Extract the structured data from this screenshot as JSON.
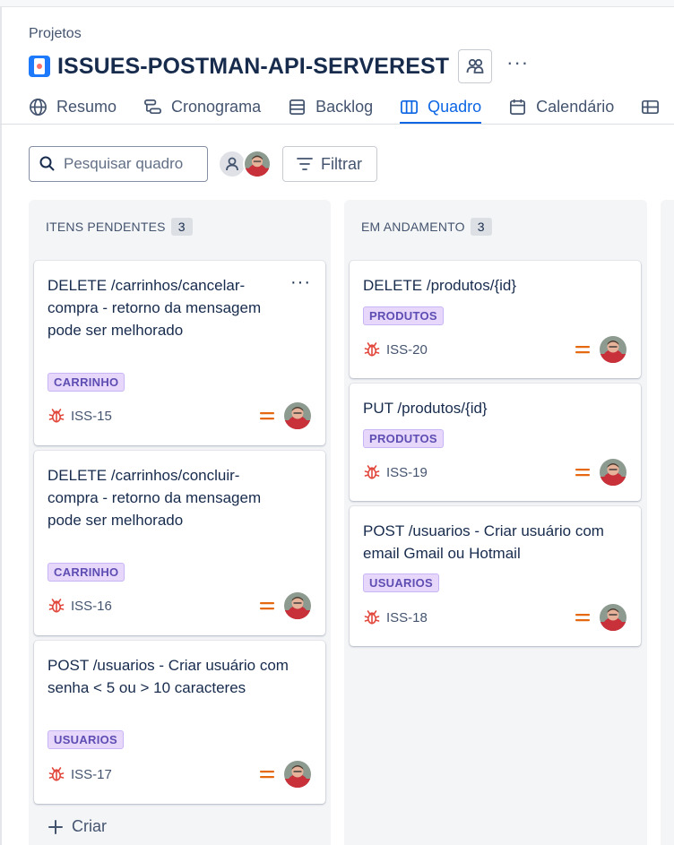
{
  "breadcrumb": "Projetos",
  "project": {
    "title": "ISSUES-POSTMAN-API-SERVEREST"
  },
  "tabs": [
    {
      "label": "Resumo",
      "icon": "globe-icon"
    },
    {
      "label": "Cronograma",
      "icon": "timeline-icon"
    },
    {
      "label": "Backlog",
      "icon": "backlog-icon"
    },
    {
      "label": "Quadro",
      "icon": "board-icon",
      "active": true
    },
    {
      "label": "Calendário",
      "icon": "calendar-icon"
    }
  ],
  "toolbar": {
    "search_placeholder": "Pesquisar quadro",
    "filter_label": "Filtrar"
  },
  "columns": [
    {
      "title": "ITENS PENDENTES",
      "count": "3",
      "create_label": "Criar",
      "cards": [
        {
          "title": "DELETE /carrinhos/cancelar-compra - retorno da mensagem pode ser melhorado",
          "label": "CARRINHO",
          "key": "ISS-15",
          "priority": "medium"
        },
        {
          "title": "DELETE /carrinhos/concluir-compra - retorno da mensagem pode ser melhorado",
          "label": "CARRINHO",
          "key": "ISS-16",
          "priority": "medium"
        },
        {
          "title": "POST /usuarios - Criar usuário com senha < 5 ou > 10 caracteres",
          "label": "USUARIOS",
          "key": "ISS-17",
          "priority": "medium"
        }
      ]
    },
    {
      "title": "EM ANDAMENTO",
      "count": "3",
      "cards": [
        {
          "title": "DELETE /produtos/{id}",
          "label": "PRODUTOS",
          "key": "ISS-20",
          "priority": "medium"
        },
        {
          "title": "PUT /produtos/{id}",
          "label": "PRODUTOS",
          "key": "ISS-19",
          "priority": "medium"
        },
        {
          "title": "POST /usuarios - Criar usuário com email Gmail ou Hotmail",
          "label": "USUARIOS",
          "key": "ISS-18",
          "priority": "medium"
        }
      ]
    }
  ],
  "colors": {
    "accent": "#0c66e4",
    "label_bg": "#e6d7fb",
    "label_text": "#5e4db2",
    "bug_icon": "#e2483d",
    "priority_medium": "#e56910",
    "column_bg": "#f4f5f7"
  }
}
